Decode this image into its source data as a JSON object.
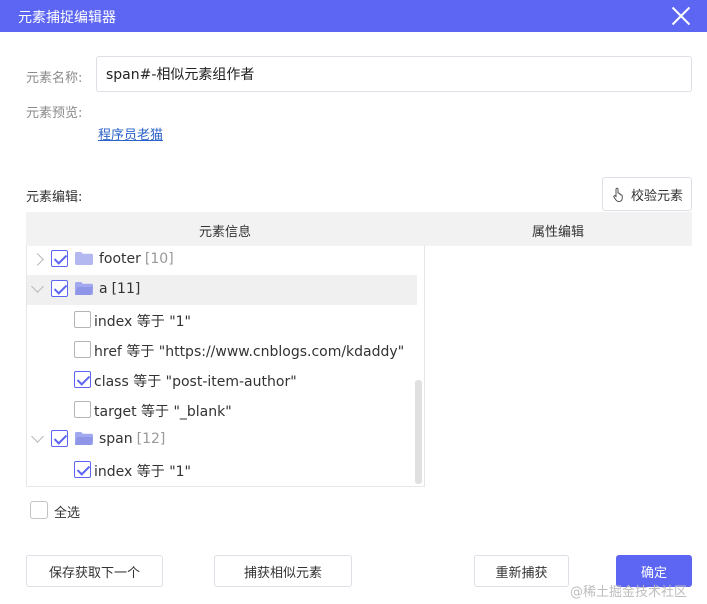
{
  "window": {
    "title": "元素捕捉编辑器"
  },
  "form": {
    "name_label": "元素名称:",
    "name_value": "span#-相似元素组作者",
    "preview_label": "元素预览:",
    "preview_link": "程序员老猫"
  },
  "editor": {
    "section_title": "元素编辑:",
    "verify_button": "校验元素",
    "columns": {
      "info": "元素信息",
      "attr": "属性编辑"
    }
  },
  "tree": {
    "nodes": [
      {
        "label": "footer",
        "count": "[10]",
        "checked": true,
        "expanded": false
      },
      {
        "label": "a",
        "count": "[11]",
        "checked": true,
        "expanded": true
      },
      {
        "label": "index 等于 \"1\"",
        "checked": false
      },
      {
        "label": "href 等于 \"https://www.cnblogs.com/kdaddy\"",
        "checked": false
      },
      {
        "label": "class 等于 \"post-item-author\"",
        "checked": true
      },
      {
        "label": "target 等于 \"_blank\"",
        "checked": false
      },
      {
        "label": "span",
        "count": "[12]",
        "checked": true,
        "expanded": true
      },
      {
        "label": "index 等于 \"1\"",
        "checked": true
      }
    ]
  },
  "select_all": {
    "label": "全选",
    "checked": false
  },
  "buttons": {
    "save_next": "保存获取下一个",
    "capture_similar": "捕获相似元素",
    "recapture": "重新捕获",
    "confirm": "确定"
  },
  "watermark": "@稀土掘金技术社区",
  "colors": {
    "accent": "#5d66f2",
    "link": "#2b63c9",
    "folder": "#b3b8f0"
  },
  "icons": {
    "close": "close-icon",
    "verify": "hand-pointer-icon",
    "folder": "folder-icon"
  }
}
